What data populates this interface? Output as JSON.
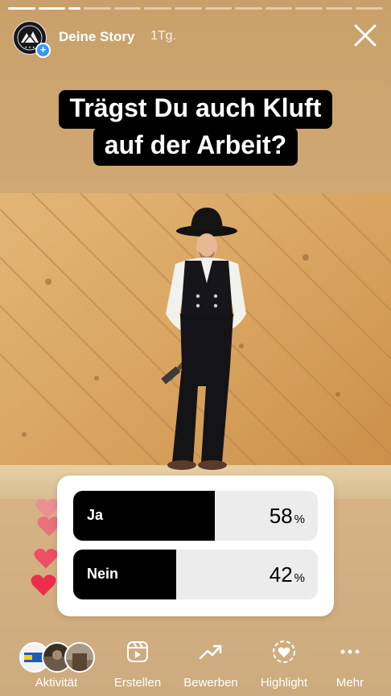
{
  "header": {
    "story_name": "Deine Story",
    "age": "1Tg.",
    "progress_segments": 14,
    "active_segment": 1
  },
  "question": {
    "line1": "Trägst Du auch Kluft",
    "line2": "auf der Arbeit?"
  },
  "poll": {
    "options": [
      {
        "label": "Ja",
        "percent": 58,
        "pct_text": "58"
      },
      {
        "label": "Nein",
        "percent": 42,
        "pct_text": "42"
      }
    ],
    "pct_sign": "%"
  },
  "bottom": {
    "items": [
      {
        "label": "Aktivität",
        "icon": "viewers-avatars-icon"
      },
      {
        "label": "Erstellen",
        "icon": "create-icon"
      },
      {
        "label": "Bewerben",
        "icon": "trend-arrow-icon"
      },
      {
        "label": "Highlight",
        "icon": "heart-circle-icon"
      },
      {
        "label": "Mehr",
        "icon": "more-dots-icon"
      }
    ]
  },
  "colors": {
    "background": "#cfa771",
    "accent_blue": "#3897f0",
    "heart_red": "#ed3b55"
  }
}
